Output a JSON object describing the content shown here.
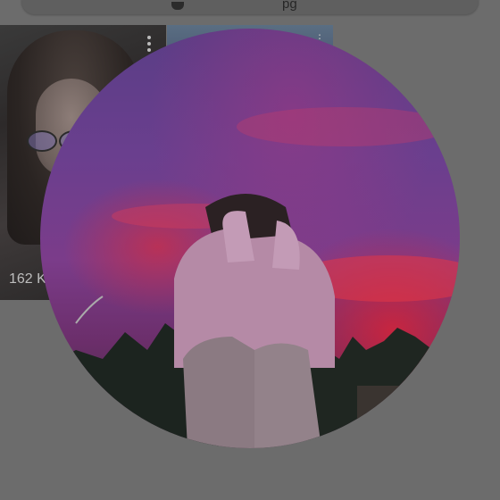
{
  "top_bar": {
    "visible_text": "pg"
  },
  "thumbnail": {
    "view_count": "162 K",
    "menu_icon": "more-vertical-icon"
  },
  "thumbnail2": {
    "menu_icon": "more-vertical-icon"
  },
  "avatar": {
    "description_icon": "profile-photo"
  }
}
